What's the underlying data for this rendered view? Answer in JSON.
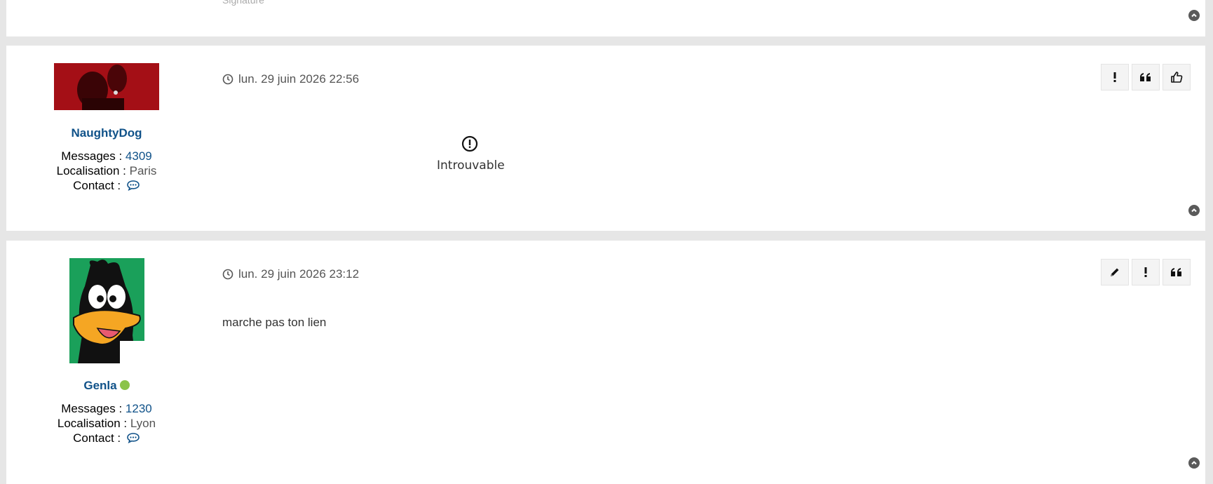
{
  "signature_label": "Signature",
  "posts": [
    {
      "author": "NaughtyDog",
      "online": false,
      "stats": {
        "messages_label": "Messages :",
        "messages_value": "4309",
        "location_label": "Localisation :",
        "location_value": "Paris",
        "contact_label": "Contact :"
      },
      "date": "lun. 29 juin 2026 22:56",
      "actions": [
        "report-icon",
        "quote-icon",
        "like-icon"
      ],
      "body_notice": "Introuvable"
    },
    {
      "author": "Genla",
      "online": true,
      "stats": {
        "messages_label": "Messages :",
        "messages_value": "1230",
        "location_label": "Localisation :",
        "location_value": "Lyon",
        "contact_label": "Contact :"
      },
      "date": "lun. 29 juin 2026 23:12",
      "actions": [
        "edit-icon",
        "report-icon",
        "quote-icon"
      ],
      "body": "marche pas ton lien"
    }
  ],
  "colors": {
    "link": "#105289",
    "online": "#8bc34a",
    "background": "#e6e6e6"
  }
}
